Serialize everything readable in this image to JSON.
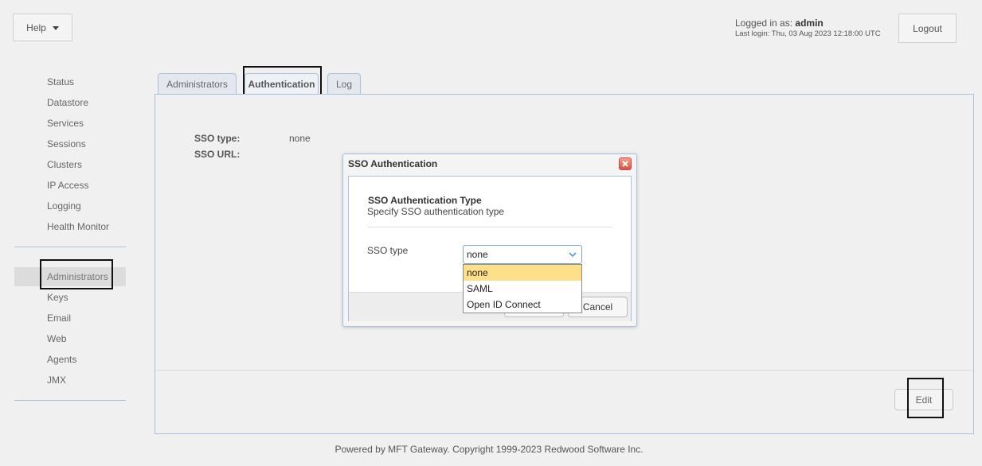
{
  "header": {
    "help_label": "Help",
    "logged_in_prefix": "Logged in as: ",
    "username": "admin",
    "last_login": "Last login: Thu, 03 Aug 2023 12:18:00 UTC",
    "logout_label": "Logout"
  },
  "sidebar": {
    "group1": [
      "Status",
      "Datastore",
      "Services",
      "Sessions",
      "Clusters",
      "IP Access",
      "Logging",
      "Health Monitor"
    ],
    "group2": [
      "Administrators",
      "Keys",
      "Email",
      "Web",
      "Agents",
      "JMX"
    ],
    "active": "Administrators"
  },
  "tabs": [
    {
      "label": "Administrators",
      "active": false
    },
    {
      "label": "Authentication",
      "active": true
    },
    {
      "label": "Log",
      "active": false
    }
  ],
  "panel": {
    "sso_type_label": "SSO type:",
    "sso_type_value": "none",
    "sso_url_label": "SSO URL:",
    "sso_url_value": "",
    "edit_label": "Edit"
  },
  "dialog": {
    "title": "SSO Authentication",
    "heading": "SSO Authentication Type",
    "subheading": "Specify SSO authentication type",
    "field_label": "SSO type",
    "selected_value": "none",
    "options": [
      "none",
      "SAML",
      "Open ID Connect"
    ],
    "cancel_label": "Cancel"
  },
  "footer": {
    "text": "Powered by MFT Gateway. Copyright 1999-2023 Redwood Software Inc."
  }
}
